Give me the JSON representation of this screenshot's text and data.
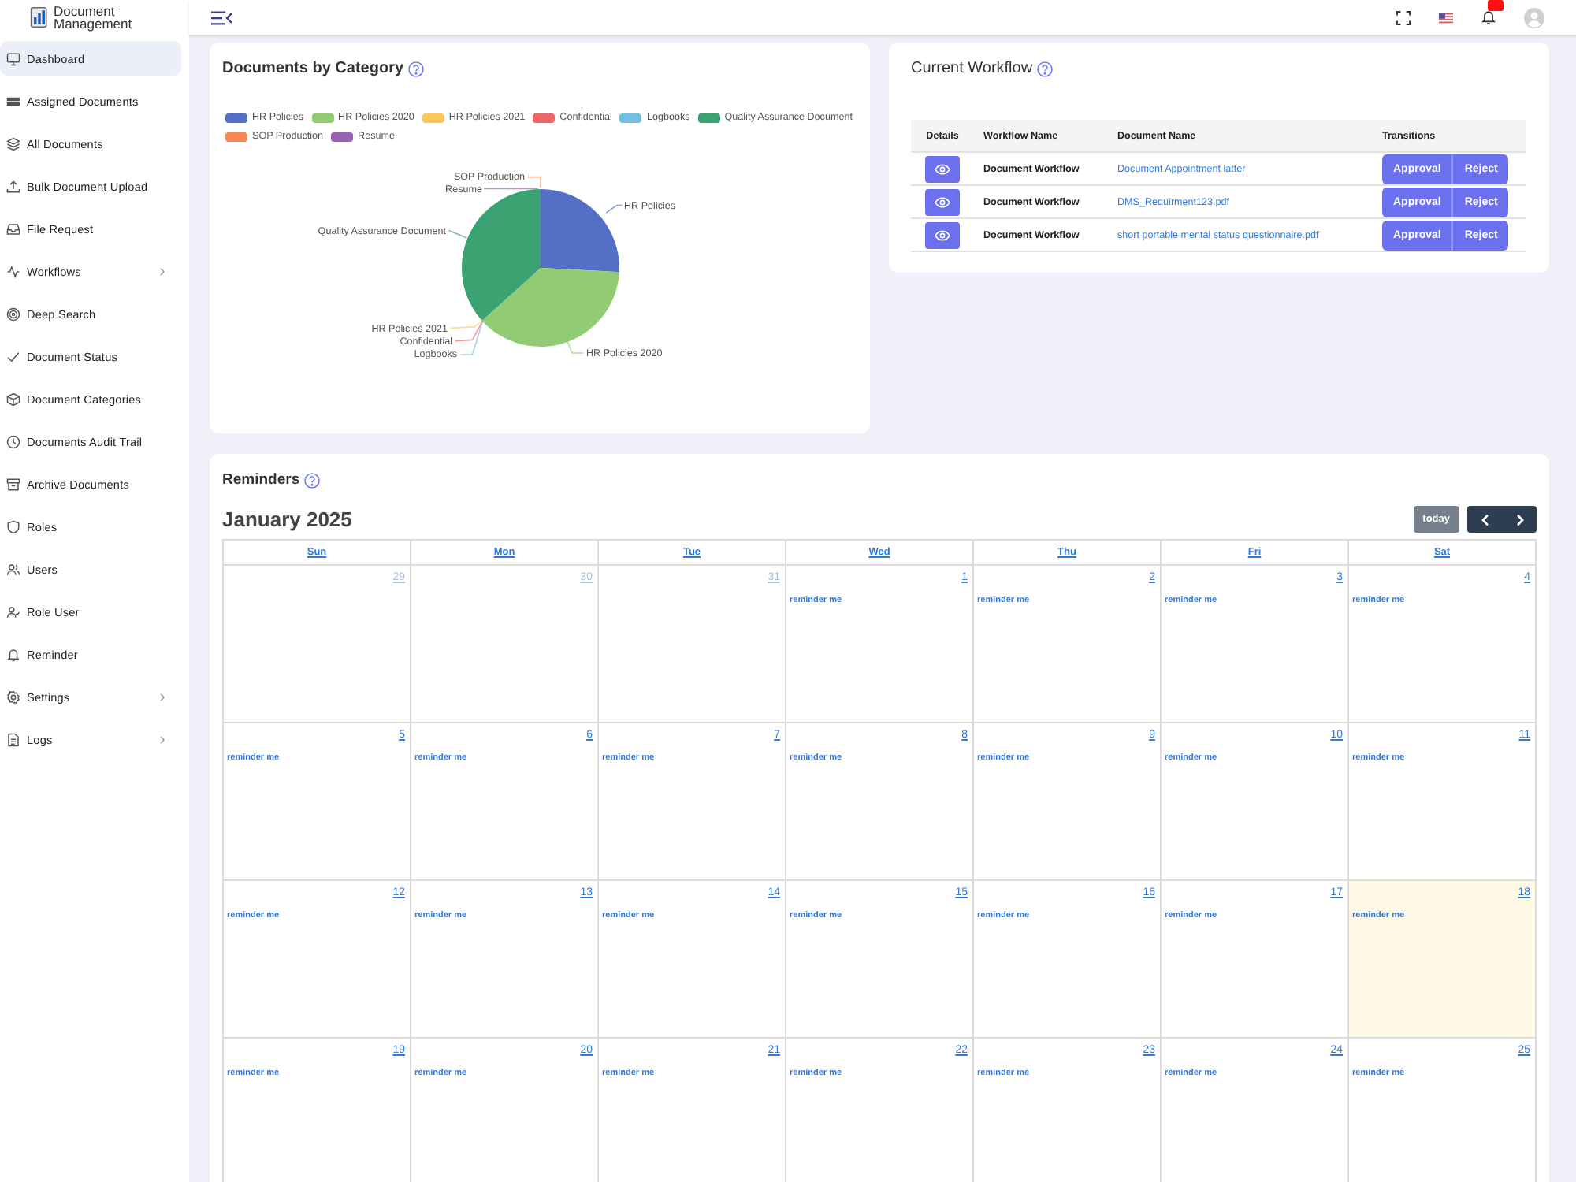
{
  "logo": {
    "text": "Document Management"
  },
  "sidebar": {
    "items": [
      {
        "label": "Dashboard",
        "selected": true,
        "submenu": false
      },
      {
        "label": "Assigned Documents",
        "selected": false,
        "submenu": false
      },
      {
        "label": "All Documents",
        "selected": false,
        "submenu": false
      },
      {
        "label": "Bulk Document Upload",
        "selected": false,
        "submenu": false
      },
      {
        "label": "File Request",
        "selected": false,
        "submenu": false
      },
      {
        "label": "Workflows",
        "selected": false,
        "submenu": true
      },
      {
        "label": "Deep Search",
        "selected": false,
        "submenu": false
      },
      {
        "label": "Document Status",
        "selected": false,
        "submenu": false
      },
      {
        "label": "Document Categories",
        "selected": false,
        "submenu": false
      },
      {
        "label": "Documents Audit Trail",
        "selected": false,
        "submenu": false
      },
      {
        "label": "Archive Documents",
        "selected": false,
        "submenu": false
      },
      {
        "label": "Roles",
        "selected": false,
        "submenu": false
      },
      {
        "label": "Users",
        "selected": false,
        "submenu": false
      },
      {
        "label": "Role User",
        "selected": false,
        "submenu": false
      },
      {
        "label": "Reminder",
        "selected": false,
        "submenu": false
      },
      {
        "label": "Settings",
        "selected": false,
        "submenu": true
      },
      {
        "label": "Logs",
        "selected": false,
        "submenu": true
      }
    ]
  },
  "documents_by_category": {
    "title": "Documents by Category",
    "legend": [
      {
        "label": "HR Policies",
        "color": "#5470c6"
      },
      {
        "label": "HR Policies 2020",
        "color": "#91cc75"
      },
      {
        "label": "HR Policies 2021",
        "color": "#fac858"
      },
      {
        "label": "Confidential",
        "color": "#ee6666"
      },
      {
        "label": "Logbooks",
        "color": "#73c0de"
      },
      {
        "label": "Quality Assurance Document",
        "color": "#3ba272"
      },
      {
        "label": "SOP Production",
        "color": "#fc8452"
      },
      {
        "label": "Resume",
        "color": "#9a60b4"
      }
    ],
    "pie_labels": [
      "SOP Production",
      "Resume",
      "HR Policies",
      "Quality Assurance Document",
      "HR Policies 2021",
      "Confidential",
      "Logbooks",
      "HR Policies 2020"
    ]
  },
  "current_workflow": {
    "title": "Current Workflow",
    "columns": [
      "Details",
      "Workflow Name",
      "Document Name",
      "Transitions"
    ],
    "rows": [
      {
        "workflow_name": "Document Workflow",
        "document_name": "Document Appointment latter",
        "actions": [
          "Approval",
          "Reject"
        ]
      },
      {
        "workflow_name": "Document Workflow",
        "document_name": "DMS_Requirment123.pdf",
        "actions": [
          "Approval",
          "Reject"
        ]
      },
      {
        "workflow_name": "Document Workflow",
        "document_name": "short portable mental status questionnaire.pdf",
        "actions": [
          "Approval",
          "Reject"
        ]
      }
    ]
  },
  "reminders": {
    "title": "Reminders",
    "calendar": {
      "title": "January 2025",
      "today_button": {
        "label": "today",
        "disabled": true
      },
      "weekdays": [
        "Sun",
        "Mon",
        "Tue",
        "Wed",
        "Thu",
        "Fri",
        "Sat"
      ],
      "weeks": [
        [
          {
            "day": "29",
            "other_month": true,
            "today": false
          },
          {
            "day": "30",
            "other_month": true,
            "today": false
          },
          {
            "day": "31",
            "other_month": true,
            "today": false
          },
          {
            "day": "1",
            "other_month": false,
            "today": false,
            "events": [
              "reminder me"
            ]
          },
          {
            "day": "2",
            "other_month": false,
            "today": false,
            "events": [
              "reminder me"
            ]
          },
          {
            "day": "3",
            "other_month": false,
            "today": false,
            "events": [
              "reminder me"
            ]
          },
          {
            "day": "4",
            "other_month": false,
            "today": false,
            "events": [
              "reminder me"
            ]
          }
        ],
        [
          {
            "day": "5",
            "other_month": false,
            "today": false,
            "events": [
              "reminder me"
            ]
          },
          {
            "day": "6",
            "other_month": false,
            "today": false,
            "events": [
              "reminder me"
            ]
          },
          {
            "day": "7",
            "other_month": false,
            "today": false,
            "events": [
              "reminder me"
            ]
          },
          {
            "day": "8",
            "other_month": false,
            "today": false,
            "events": [
              "reminder me"
            ]
          },
          {
            "day": "9",
            "other_month": false,
            "today": false,
            "events": [
              "reminder me"
            ]
          },
          {
            "day": "10",
            "other_month": false,
            "today": false,
            "events": [
              "reminder me"
            ]
          },
          {
            "day": "11",
            "other_month": false,
            "today": false,
            "events": [
              "reminder me"
            ]
          }
        ],
        [
          {
            "day": "12",
            "other_month": false,
            "today": false,
            "events": [
              "reminder me"
            ]
          },
          {
            "day": "13",
            "other_month": false,
            "today": false,
            "events": [
              "reminder me"
            ]
          },
          {
            "day": "14",
            "other_month": false,
            "today": false,
            "events": [
              "reminder me"
            ]
          },
          {
            "day": "15",
            "other_month": false,
            "today": false,
            "events": [
              "reminder me"
            ]
          },
          {
            "day": "16",
            "other_month": false,
            "today": false,
            "events": [
              "reminder me"
            ]
          },
          {
            "day": "17",
            "other_month": false,
            "today": false,
            "events": [
              "reminder me"
            ]
          },
          {
            "day": "18",
            "other_month": false,
            "today": true,
            "events": [
              "reminder me"
            ]
          }
        ],
        [
          {
            "day": "19",
            "other_month": false,
            "today": false,
            "events": [
              "reminder me"
            ]
          },
          {
            "day": "20",
            "other_month": false,
            "today": false,
            "events": [
              "reminder me"
            ]
          },
          {
            "day": "21",
            "other_month": false,
            "today": false,
            "events": [
              "reminder me"
            ]
          },
          {
            "day": "22",
            "other_month": false,
            "today": false,
            "events": [
              "reminder me"
            ]
          },
          {
            "day": "23",
            "other_month": false,
            "today": false,
            "events": [
              "reminder me"
            ]
          },
          {
            "day": "24",
            "other_month": false,
            "today": false,
            "events": [
              "reminder me"
            ]
          },
          {
            "day": "25",
            "other_month": false,
            "today": false,
            "events": [
              "reminder me"
            ]
          }
        ]
      ]
    }
  }
}
